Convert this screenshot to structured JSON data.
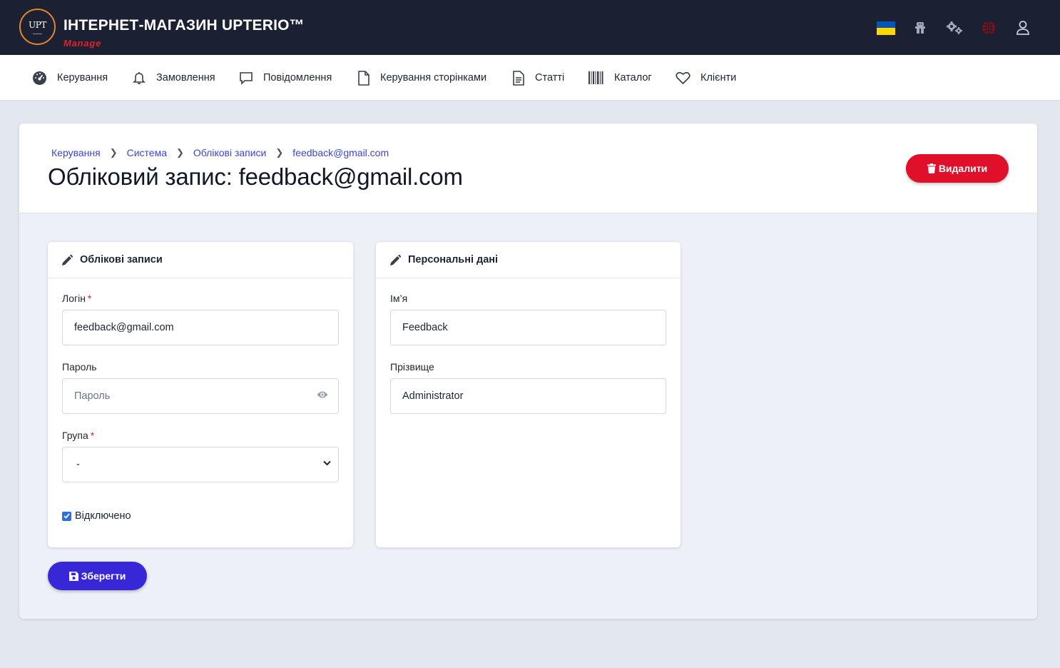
{
  "header": {
    "logo_text": "UPT",
    "title": "ІНТЕРНЕТ-МАГАЗИН UPTERIO™",
    "subtitle": "Manage",
    "icons": [
      "ukraine-flag-icon",
      "robot-icon",
      "gears-icon",
      "globe-icon",
      "user-icon"
    ],
    "colors": {
      "background": "#1b2132",
      "accent": "#e5862f",
      "subtitle": "#e3202b"
    }
  },
  "nav": {
    "items": [
      {
        "label": "Керування",
        "icon": "dashboard-icon"
      },
      {
        "label": "Замовлення",
        "icon": "bell-icon"
      },
      {
        "label": "Повідомлення",
        "icon": "chat-icon"
      },
      {
        "label": "Керування сторінками",
        "icon": "file-icon"
      },
      {
        "label": "Статті",
        "icon": "document-icon"
      },
      {
        "label": "Каталог",
        "icon": "barcode-icon"
      },
      {
        "label": "Клієнти",
        "icon": "heart-icon"
      }
    ]
  },
  "breadcrumb": [
    "Керування",
    "Система",
    "Облікові записи",
    "feedback@gmail.com"
  ],
  "page": {
    "title": "Обліковий запис: feedback@gmail.com",
    "delete_label": "Видалити",
    "save_label": "Зберегти"
  },
  "accounts_panel": {
    "title": "Облікові записи",
    "login_label": "Логін",
    "login_value": "feedback@gmail.com",
    "password_label": "Пароль",
    "password_placeholder": "Пароль",
    "group_label": "Група",
    "group_value": "-",
    "disabled_label": "Відключено",
    "disabled_checked": true,
    "required_mark": "*"
  },
  "personal_panel": {
    "title": "Персональні дані",
    "first_name_label": "Ім’я",
    "first_name_value": "Feedback",
    "last_name_label": "Прізвище",
    "last_name_value": "Administrator"
  },
  "colors": {
    "link": "#3b45d6",
    "danger": "#e0102a",
    "primary": "#3727d6",
    "checkbox": "#2c6fe4"
  }
}
